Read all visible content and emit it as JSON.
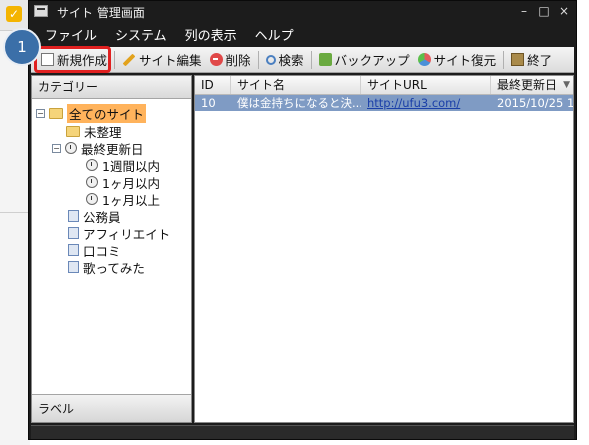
{
  "window": {
    "title": "サイト 管理画面",
    "controls": [
      "–",
      "□",
      "×"
    ]
  },
  "menu": [
    "ファイル",
    "システム",
    "列の表示",
    "ヘルプ"
  ],
  "toolbar": {
    "new": "新規作成",
    "edit": "サイト編集",
    "delete": "削除",
    "search": "検索",
    "backup": "バックアップ",
    "restore": "サイト復元",
    "exit": "終了"
  },
  "step_badge": "1",
  "left_pane": {
    "header": "カテゴリー",
    "footer": "ラベル",
    "tree": {
      "all": "全てのサイト",
      "unsorted": "未整理",
      "last_updated": "最終更新日",
      "within_week": "1週間以内",
      "within_month": "1ヶ月以内",
      "over_month": "1ヶ月以上",
      "cat1": "公務員",
      "cat2": "アフィリエイト",
      "cat3": "口コミ",
      "cat4": "歌ってみた"
    }
  },
  "grid": {
    "columns": [
      "ID",
      "サイト名",
      "サイトURL",
      "最終更新日"
    ],
    "rows": [
      {
        "id": "10",
        "name": "僕は金持ちになると決...",
        "url": "http://ufu3.com/",
        "date": "2015/10/25 1..."
      }
    ]
  },
  "icons": {
    "new": "new-document-icon",
    "edit": "pencil-icon",
    "delete": "delete-icon",
    "search": "search-icon",
    "backup": "backup-icon",
    "restore": "restore-icon",
    "exit": "exit-icon"
  },
  "colors": {
    "highlight": "#e02020",
    "badge": "#3b6fa8",
    "selection": "#7f9bc4",
    "tree_selected": "#ffb35c"
  }
}
